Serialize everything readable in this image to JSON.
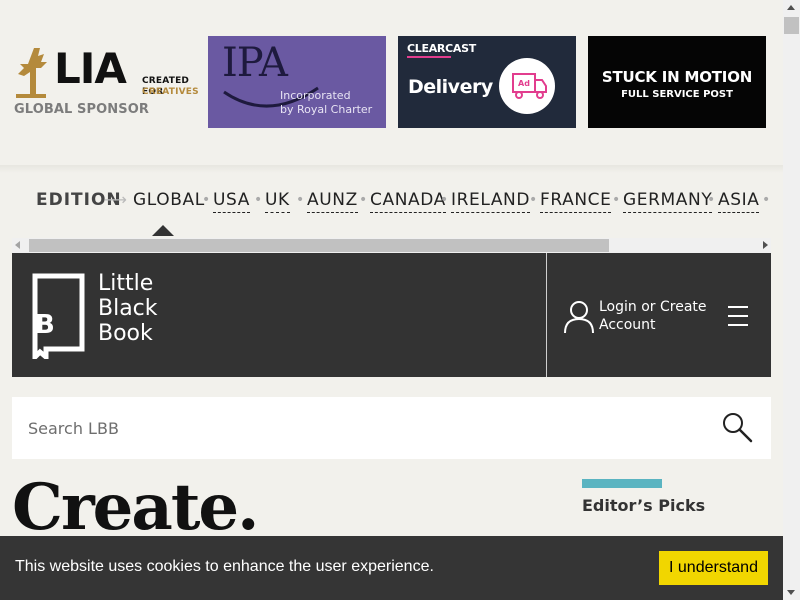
{
  "sponsors": {
    "lia": {
      "name": "LIA",
      "tagline_1": "CREATED FOR",
      "tagline_2": "CREATIVES",
      "label": "GLOBAL SPONSOR"
    },
    "ipa": {
      "name": "IPA",
      "line_1": "Incorporated",
      "line_2": "by Royal Charter"
    },
    "clearcast": {
      "brand": "CLEARCAST",
      "title": "Delivery",
      "icon_text": "Ad"
    },
    "stuck_in_motion": {
      "line_1": "STUCK IN MOTION",
      "line_2": "FULL SERVICE POST"
    }
  },
  "edition": {
    "label": "EDITION",
    "arrow": "⟶",
    "items": [
      "GLOBAL",
      "USA",
      "UK",
      "AUNZ",
      "CANADA",
      "IRELAND",
      "FRANCE",
      "GERMANY",
      "ASIA"
    ],
    "selected": "GLOBAL"
  },
  "header": {
    "logo_lines": [
      "Little",
      "Black",
      "Book"
    ],
    "logo_letter": "B",
    "login_line_1": "Login or Create",
    "login_line_2": "Account"
  },
  "search": {
    "placeholder": "Search LBB"
  },
  "main": {
    "headline": "Create."
  },
  "sidebar": {
    "editors_picks_title": "Editor’s Picks"
  },
  "cookie": {
    "message": "This website uses cookies to enhance the user experience.",
    "button_label": "I understand"
  },
  "colors": {
    "background": "#f2f1ec",
    "header": "#333333",
    "accent_teal": "#5ab4c1",
    "cookie_button": "#f1d600",
    "ipa_purple": "#6a59a2",
    "clearcast_navy": "#212a3b",
    "lia_gold": "#b48a3c"
  }
}
